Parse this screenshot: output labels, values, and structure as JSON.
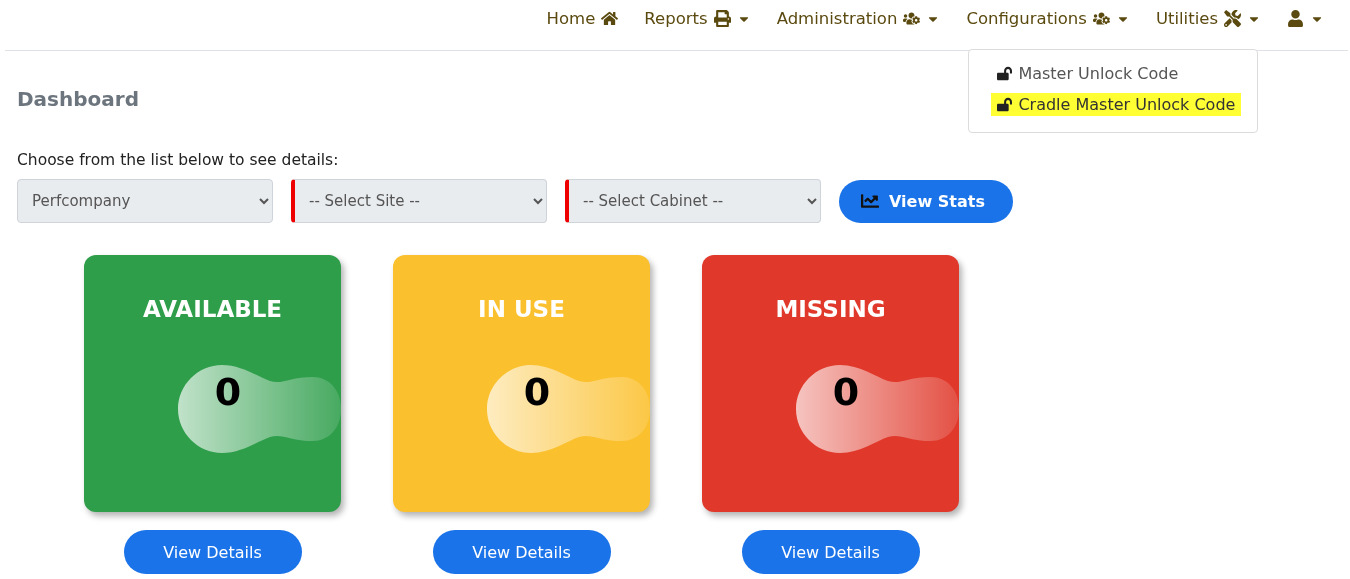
{
  "nav": [
    {
      "kind": "link",
      "label": "Home"
    },
    {
      "kind": "dropdown",
      "label": "Reports"
    },
    {
      "kind": "dropdown",
      "label": "Administration"
    },
    {
      "kind": "dropdown",
      "label": "Configurations",
      "expanded": true
    },
    {
      "kind": "dropdown",
      "label": "Utilities"
    },
    {
      "kind": "account"
    }
  ],
  "menu": [
    {
      "label": "Master Unlock Code",
      "highlighted": false
    },
    {
      "label": "Cradle Master Unlock Code",
      "highlighted": true
    }
  ],
  "page_title": "Dashboard",
  "prompt": "Choose from the list below to see details:",
  "filters": [
    {
      "value": "Perfcompany",
      "invalid": false
    },
    {
      "value": "-- Select Site --",
      "invalid": true
    },
    {
      "value": "-- Select Cabinet --",
      "invalid": true
    }
  ],
  "stats_button": "View Stats",
  "cards": [
    {
      "title": "AVAILABLE",
      "count": "0",
      "color": "#2e9e4b",
      "button": "View Details"
    },
    {
      "title": "IN USE",
      "count": "0",
      "color": "#fbc02d",
      "button": "View Details"
    },
    {
      "title": "MISSING",
      "count": "0",
      "color": "#e0392b",
      "button": "View Details"
    }
  ]
}
